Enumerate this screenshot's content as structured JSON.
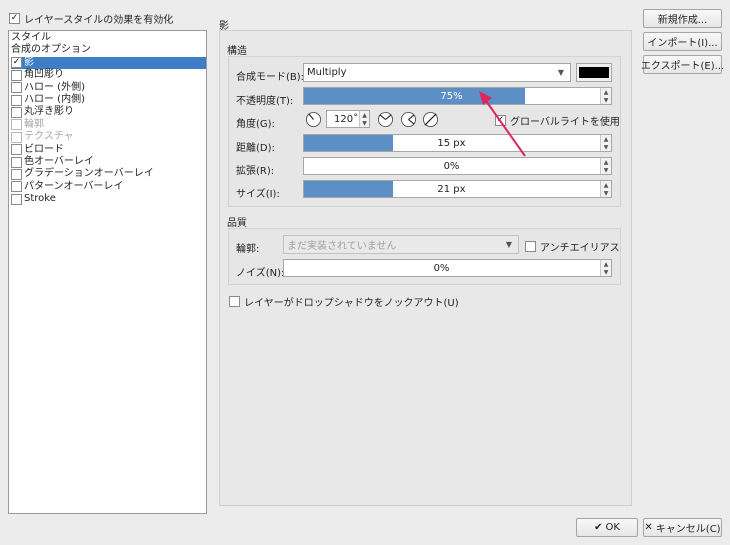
{
  "enable_styles": {
    "label": "レイヤースタイルの効果を有効化",
    "checked": true
  },
  "style_list": [
    {
      "label": "スタイル",
      "checkbox": false,
      "checked": false,
      "selected": false,
      "disabled": false
    },
    {
      "label": "合成のオプション",
      "checkbox": false,
      "checked": false,
      "selected": false,
      "disabled": false
    },
    {
      "label": "影",
      "checkbox": true,
      "checked": true,
      "selected": true,
      "disabled": false
    },
    {
      "label": "角凹彫り",
      "checkbox": true,
      "checked": false,
      "selected": false,
      "disabled": false
    },
    {
      "label": "ハロー (外側)",
      "checkbox": true,
      "checked": false,
      "selected": false,
      "disabled": false
    },
    {
      "label": "ハロー (内側)",
      "checkbox": true,
      "checked": false,
      "selected": false,
      "disabled": false
    },
    {
      "label": "丸浮き彫り",
      "checkbox": true,
      "checked": false,
      "selected": false,
      "disabled": false
    },
    {
      "label": "輪郭",
      "checkbox": true,
      "checked": false,
      "selected": false,
      "disabled": true
    },
    {
      "label": "テクスチャ",
      "checkbox": true,
      "checked": false,
      "selected": false,
      "disabled": true
    },
    {
      "label": "ビロード",
      "checkbox": true,
      "checked": false,
      "selected": false,
      "disabled": false
    },
    {
      "label": "色オーバーレイ",
      "checkbox": true,
      "checked": false,
      "selected": false,
      "disabled": false
    },
    {
      "label": "グラデーションオーバーレイ",
      "checkbox": true,
      "checked": false,
      "selected": false,
      "disabled": false
    },
    {
      "label": "パターンオーバーレイ",
      "checkbox": true,
      "checked": false,
      "selected": false,
      "disabled": false
    },
    {
      "label": "Stroke",
      "checkbox": true,
      "checked": false,
      "selected": false,
      "disabled": false
    }
  ],
  "panel_title": "影",
  "structure": {
    "title": "構造",
    "blend_mode_label": "合成モード(B):",
    "blend_mode_value": "Multiply",
    "color": "#000000",
    "opacity_label": "不透明度(T):",
    "opacity_value": "75%",
    "opacity_fraction": 0.75,
    "angle_label": "角度(G):",
    "angle_value": "120˚",
    "global_light_label": "グローバルライトを使用",
    "global_light_checked": true,
    "distance_label": "距離(D):",
    "distance_value": "15 px",
    "distance_fraction": 0.3,
    "spread_label": "拡張(R):",
    "spread_value": "0%",
    "spread_fraction": 0.0,
    "size_label": "サイズ(I):",
    "size_value": "21 px",
    "size_fraction": 0.3
  },
  "quality": {
    "title": "品質",
    "contour_label": "輪郭:",
    "contour_value": "まだ実装されていません",
    "antialias_label": "アンチエイリアス",
    "antialias_checked": false,
    "noise_label": "ノイズ(N):",
    "noise_value": "0%",
    "noise_fraction": 0.0
  },
  "knockout": {
    "label": "レイヤーがドロップシャドウをノックアウト(U)",
    "checked": false
  },
  "buttons": {
    "new": "新規作成...",
    "import": "インポート(I)...",
    "export": "エクスポート(E)...",
    "ok": "OK",
    "cancel": "キャンセル(C)"
  },
  "colors": {
    "accent": "#3d7ec7",
    "slider_fill": "#5b8fc6",
    "arrow": "#e0245e"
  }
}
